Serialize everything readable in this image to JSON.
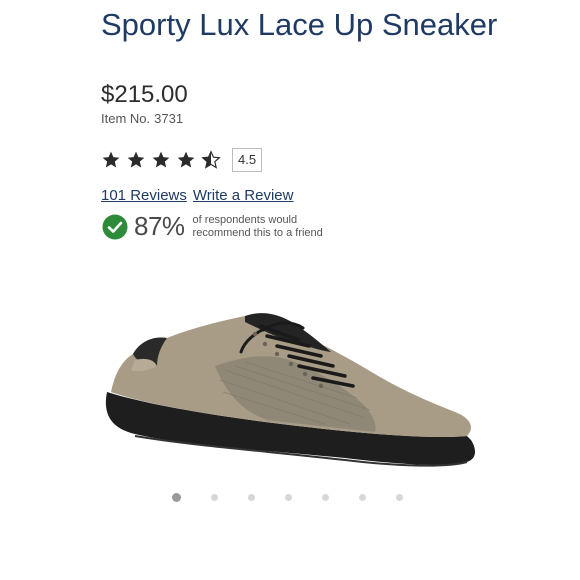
{
  "product": {
    "title": "Sporty Lux Lace Up Sneaker",
    "price": "$215.00",
    "item_label": "Item No.",
    "item_number": "3731"
  },
  "rating": {
    "value": 4.5,
    "value_label": "4.5",
    "stars_total": 5,
    "star_color": "#2b2b2b"
  },
  "links": {
    "reviews": "101 Reviews",
    "write_review": "Write a Review"
  },
  "recommend": {
    "percent": "87%",
    "text": "of respondents would recommend this to a friend",
    "check_color": "#2e8b3a"
  },
  "carousel": {
    "dot_count": 7,
    "active_index": 0
  },
  "colors": {
    "title": "#1f3a63",
    "link": "#1f3a63"
  }
}
